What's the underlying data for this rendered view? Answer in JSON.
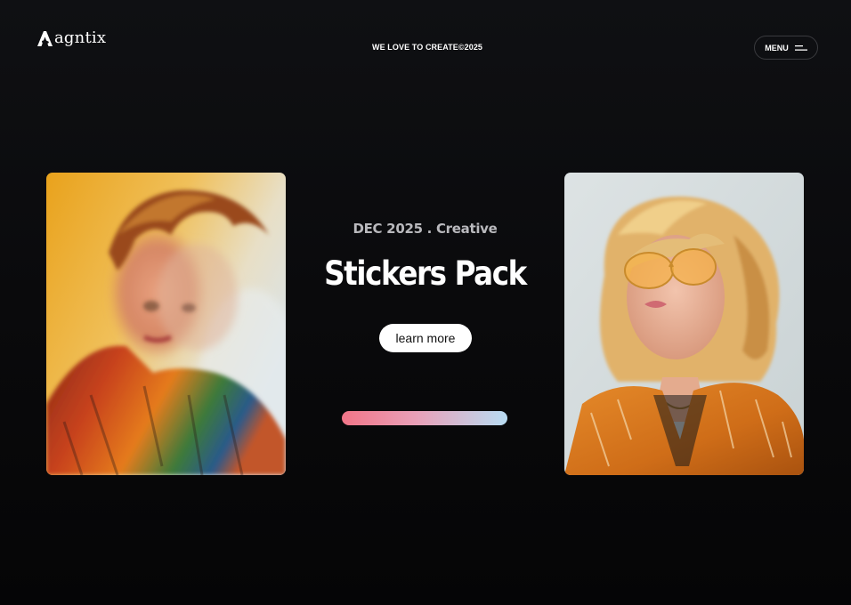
{
  "header": {
    "logo_text": "agntix",
    "tagline": "WE LOVE TO CREATE©2025",
    "menu_label": "MENU"
  },
  "hero": {
    "eyebrow": "DEC 2025 . Creative",
    "title": "Stickers Pack",
    "cta_label": "learn more",
    "progress_colors": [
      "#f17588",
      "#b8dcf3"
    ]
  },
  "photos": {
    "left_icon": "portrait-photo",
    "right_icon": "portrait-photo"
  },
  "colors": {
    "background": "#0c0c0e",
    "accent_pink": "#f17588",
    "accent_blue": "#b8dcf3"
  }
}
